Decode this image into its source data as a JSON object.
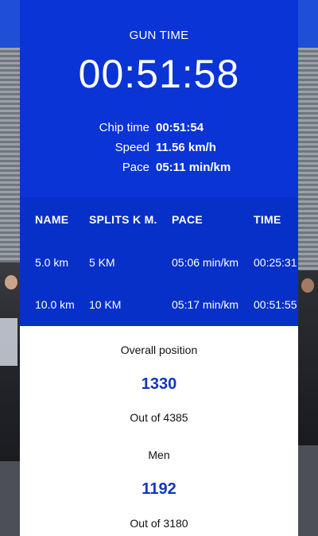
{
  "timing": {
    "gun_label": "GUN TIME",
    "gun_time": "00:51:58",
    "chip_label": "Chip time",
    "chip_value": "00:51:54",
    "speed_label": "Speed",
    "speed_value": "11.56 km/h",
    "pace_label": "Pace",
    "pace_value": "05:11 min/km"
  },
  "splits": {
    "headers": [
      "NAME",
      "SPLITS K M.",
      "PACE",
      "TIME"
    ],
    "rows": [
      [
        "5.0 km",
        "5 KM",
        "05:06 min/km",
        "00:25:31"
      ],
      [
        "10.0 km",
        "10 KM",
        "05:17 min/km",
        "00:51:55"
      ]
    ]
  },
  "results": {
    "overall_label": "Overall position",
    "overall_position": "1330",
    "overall_out_of": "Out of 4385",
    "category_label": "Men",
    "category_position": "1192",
    "category_out_of": "Out of 3180"
  },
  "colors": {
    "panel_blue": "#0a34d6",
    "table_blue": "#0730c9",
    "number_blue": "#1237b5"
  }
}
